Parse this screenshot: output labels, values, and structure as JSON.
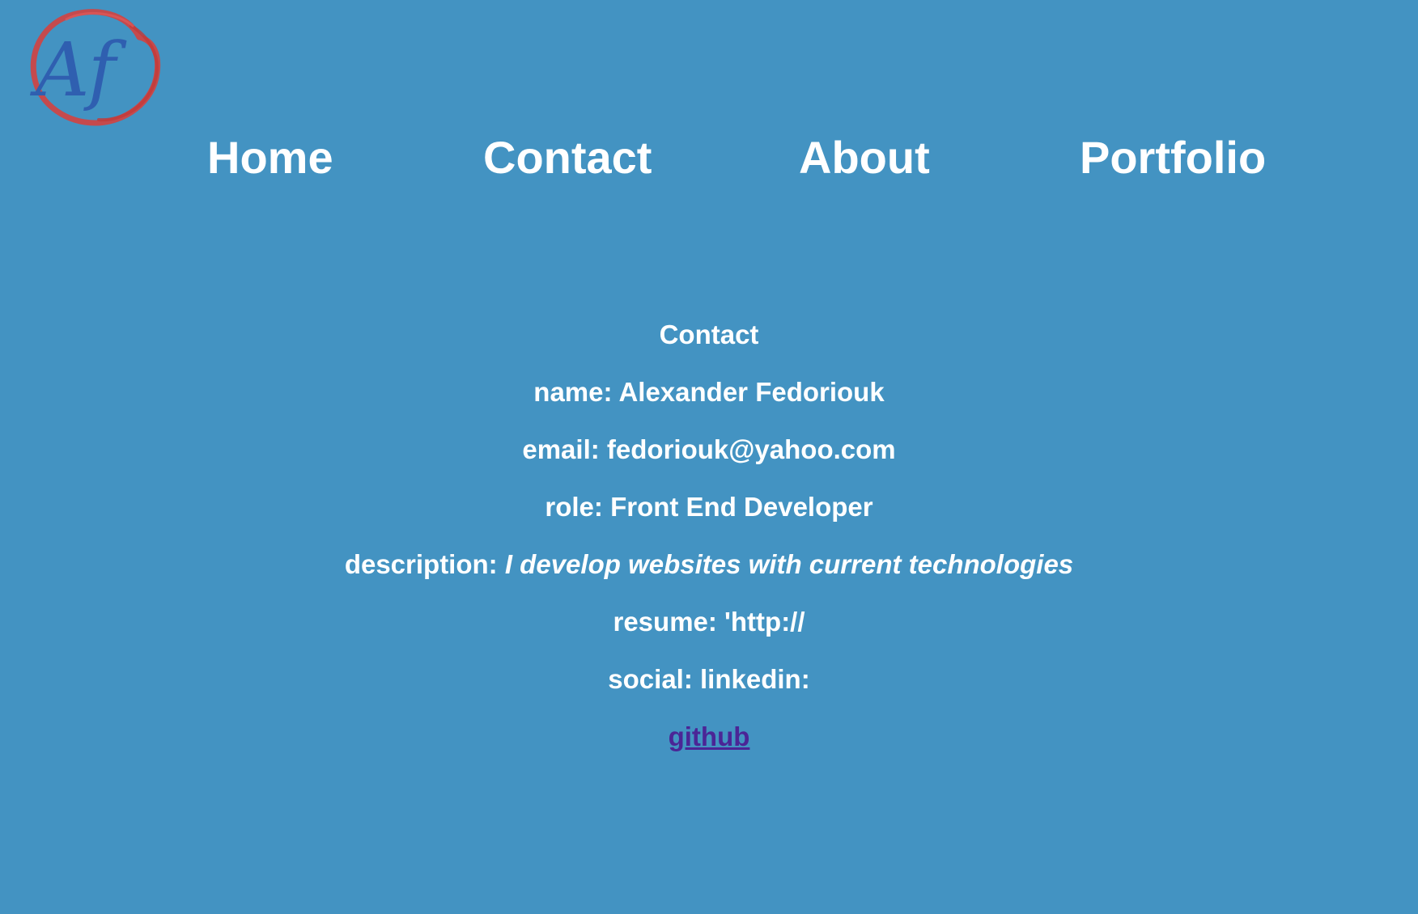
{
  "logo": {
    "text": "Af",
    "colors": {
      "letters": "#2f5fb0",
      "ring": "#d04343"
    }
  },
  "nav": {
    "items": [
      {
        "label": "Home"
      },
      {
        "label": "Contact"
      },
      {
        "label": "About"
      },
      {
        "label": "Portfolio"
      }
    ]
  },
  "contact": {
    "title": "Contact",
    "name_label": "name:",
    "name_value": "Alexander Fedoriouk",
    "email_label": "email:",
    "email_value": "fedoriouk@yahoo.com",
    "role_label": "role:",
    "role_value": "Front End Developer",
    "description_label": "description:",
    "description_value": "I develop websites with current technologies",
    "resume_label": "resume:",
    "resume_value": "'http://",
    "social_label": "social:",
    "social_value": "linkedin:",
    "github_label": "github"
  },
  "colors": {
    "background": "#4393c2",
    "text": "#ffffff",
    "link": "#4b2596"
  }
}
